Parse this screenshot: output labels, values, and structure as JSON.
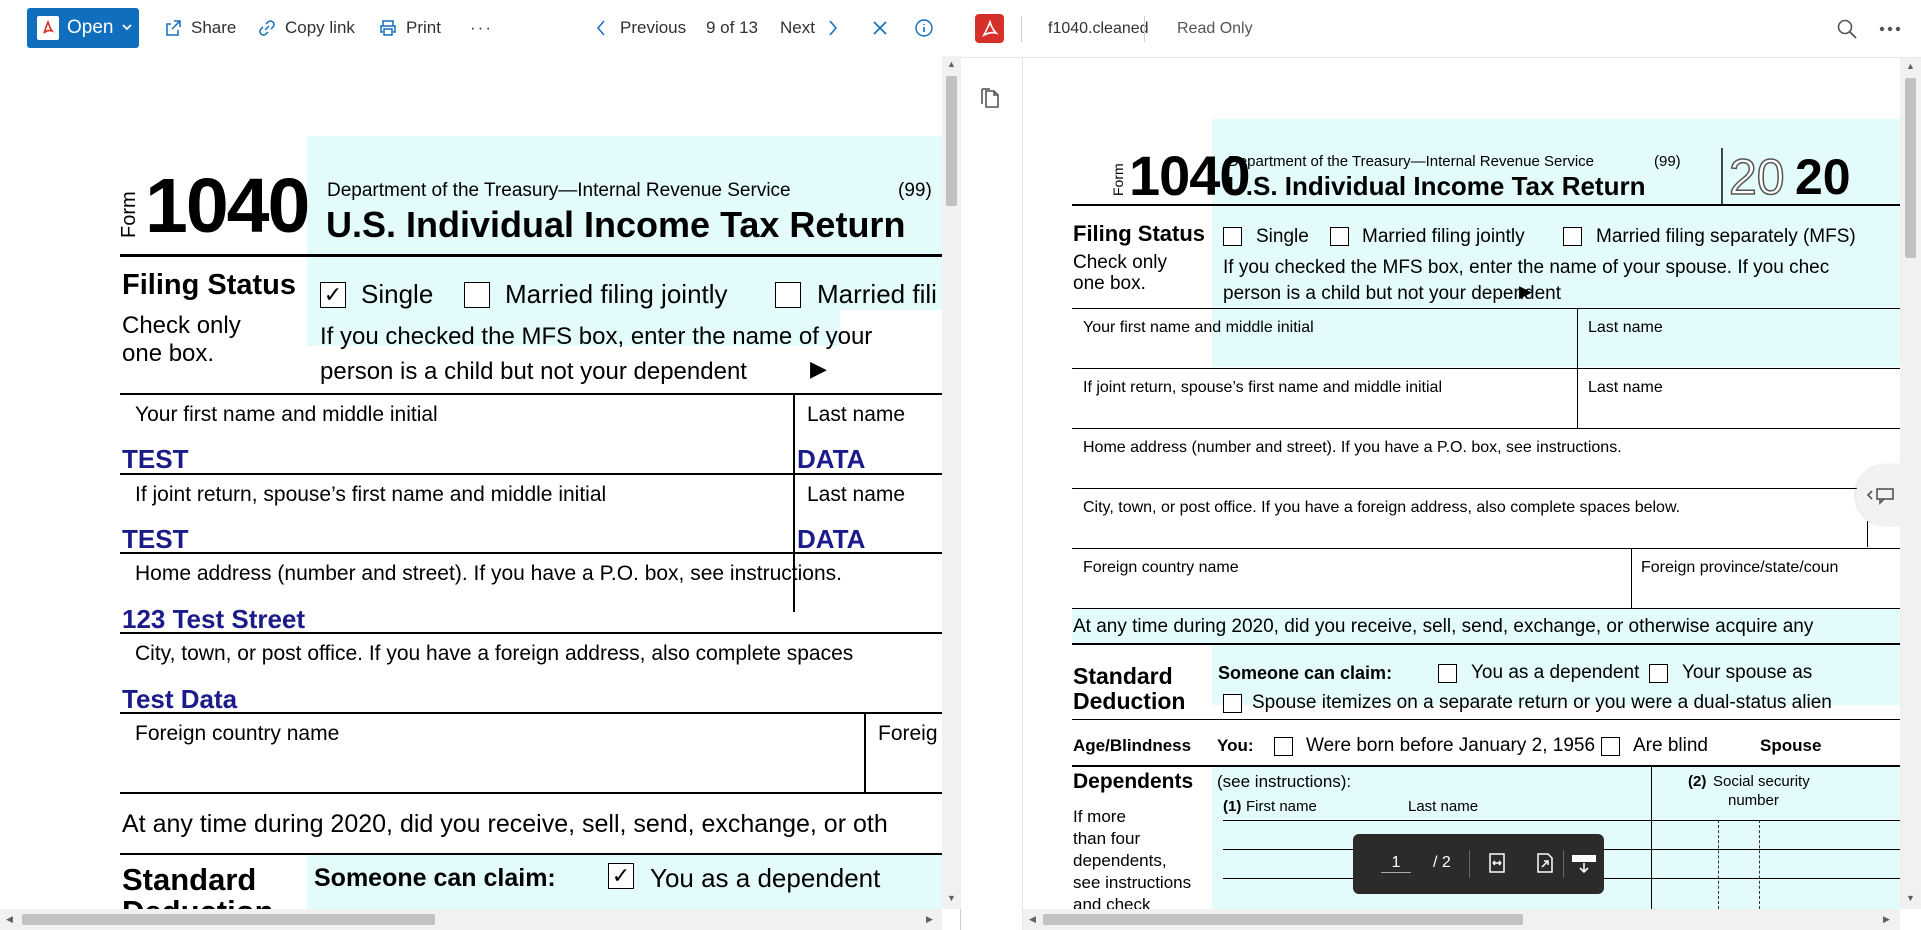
{
  "left_viewer": {
    "toolbar": {
      "open_label": "Open",
      "share_label": "Share",
      "copy_link_label": "Copy link",
      "print_label": "Print",
      "more_label": "···",
      "previous_label": "Previous",
      "position": "9 of 13",
      "next_label": "Next"
    },
    "form": {
      "form_word": "Form",
      "form_number": "1040",
      "agency": "Department of the Treasury—Internal Revenue Service",
      "code": "(99)",
      "title": "U.S. Individual Income Tax Return",
      "filing_status_heading": "Filing Status",
      "check_only": "Check only",
      "one_box": "one box.",
      "single_label": "Single",
      "mfj_label": "Married filing jointly",
      "mfs_label": "Married fili",
      "mfs_note_1": "If you checked the MFS box, enter the name of your",
      "mfs_note_2": "person is a child but not your dependent",
      "arrow_glyph": "▶",
      "first_name_label": "Your first name and middle initial",
      "last_name_label": "Last name",
      "first_name_value": "TEST",
      "last_name_value": "DATA",
      "spouse_first_label": "If joint return, spouse’s first name and middle initial",
      "spouse_last_label": "Last name",
      "spouse_first_value": "TEST",
      "spouse_last_value": "DATA",
      "home_address_label": "Home address (number and street). If you have a P.O. box, see instructions.",
      "home_address_value": "123 Test Street",
      "city_label": "City, town, or post office. If you have a foreign address, also complete spaces",
      "city_value": "Test Data",
      "foreign_country_label": "Foreign country name",
      "foreign_province_label": "Foreig",
      "virtual_currency_question": "At any time during 2020, did you receive, sell, send, exchange, or oth",
      "standard_deduction_1": "Standard",
      "standard_deduction_2": "Deduction",
      "someone_can_claim": "Someone can claim:",
      "you_as_dependent": "You as a dependent",
      "check_glyph": "✓"
    }
  },
  "right_viewer": {
    "toolbar": {
      "filename": "f1040.cleaned",
      "mode": "Read Only"
    },
    "form": {
      "form_word": "Form",
      "form_number": "1040",
      "agency": "Department of the Treasury—Internal Revenue Service",
      "code": "(99)",
      "title": "U.S. Individual Income Tax Return",
      "year_outline": "20",
      "year_bold": "20",
      "filing_status_heading": "Filing Status",
      "check_only": "Check only",
      "one_box": "one box.",
      "single_label": "Single",
      "mfj_label": "Married filing jointly",
      "mfs_label": "Married filing separately (MFS)",
      "mfs_note_1": "If you checked the MFS box, enter the name of your spouse. If you chec",
      "mfs_note_2": "person is a child but not your dependent",
      "arrow_glyph": "▶",
      "first_name_label": "Your first name and middle initial",
      "last_name_label": "Last name",
      "spouse_first_label": "If joint return, spouse’s first name and middle initial",
      "spouse_last_label": "Last name",
      "home_address_label": "Home address (number and street). If you have a P.O. box, see instructions.",
      "city_label": "City, town, or post office. If you have a foreign address, also complete spaces below.",
      "foreign_country_label": "Foreign country name",
      "foreign_province_label": "Foreign province/state/coun",
      "virtual_currency_question": "At any time during 2020, did you receive, sell, send, exchange, or otherwise acquire any",
      "standard_deduction_1": "Standard",
      "standard_deduction_2": "Deduction",
      "someone_can_claim": "Someone can claim:",
      "you_as_dependent": "You as a dependent",
      "your_spouse_as": "Your spouse as",
      "spouse_itemizes": "Spouse itemizes on a separate return or you were a dual-status alien",
      "age_blindness": "Age/Blindness",
      "you_label": "You:",
      "born_before": "Were born before January 2, 1956",
      "are_blind": "Are blind",
      "spouse_label": "Spouse",
      "dependents_heading": "Dependents",
      "see_instructions": "(see instructions):",
      "col1_num": "(1)",
      "col1_first": "First name",
      "col1_last": "Last name",
      "col2_num": "(2)",
      "col2_title_1": "Social security",
      "col2_title_2": "number",
      "if_more_1": "If more",
      "if_more_2": "than four",
      "if_more_3": "dependents,",
      "if_more_4": "see instructions",
      "if_more_5": "and check"
    },
    "page_bar": {
      "current_page": "1",
      "total_pages": "/ 2"
    }
  },
  "colors": {
    "accent_blue": "#106ebe",
    "acrobat_red": "#d7302a",
    "form_teal": "#e3fbfb",
    "filled_text": "#1b1b8a"
  }
}
